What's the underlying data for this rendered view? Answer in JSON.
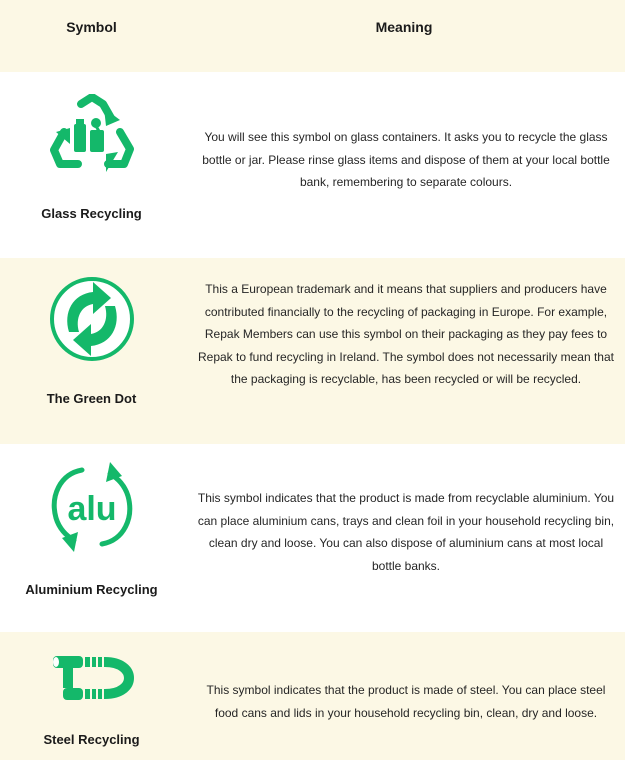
{
  "header": {
    "symbol": "Symbol",
    "meaning": "Meaning"
  },
  "colors": {
    "accent": "#14b86a",
    "cream": "#fcf8e5"
  },
  "rows": [
    {
      "label": "Glass Recycling",
      "icon": "glass-recycling-icon",
      "meaning": "You will see this symbol on glass containers. It asks you to recycle the glass bottle or jar. Please rinse glass items and dispose of them at your local bottle bank, remembering to separate colours."
    },
    {
      "label": "The Green Dot",
      "icon": "green-dot-icon",
      "meaning": "This a European trademark and it means that suppliers and producers have contributed financially to the recycling of packaging in Europe. For example, Repak Members can use this symbol on their packaging as they pay fees to Repak to fund recycling in Ireland. The symbol does not necessarily mean that the packaging is recyclable, has been recycled or will be recycled."
    },
    {
      "label": "Aluminium Recycling",
      "icon": "aluminium-recycling-icon",
      "icon_text": "alu",
      "meaning": "This symbol indicates that the product is made from recyclable aluminium. You can place aluminium cans, trays and clean foil in your household recycling bin, clean dry and loose.  You can also dispose of aluminium cans at most local bottle banks."
    },
    {
      "label": "Steel Recycling",
      "icon": "steel-recycling-icon",
      "meaning": "This symbol indicates that the product is made of steel. You can place steel food cans and lids in your household recycling bin, clean, dry and loose."
    }
  ]
}
